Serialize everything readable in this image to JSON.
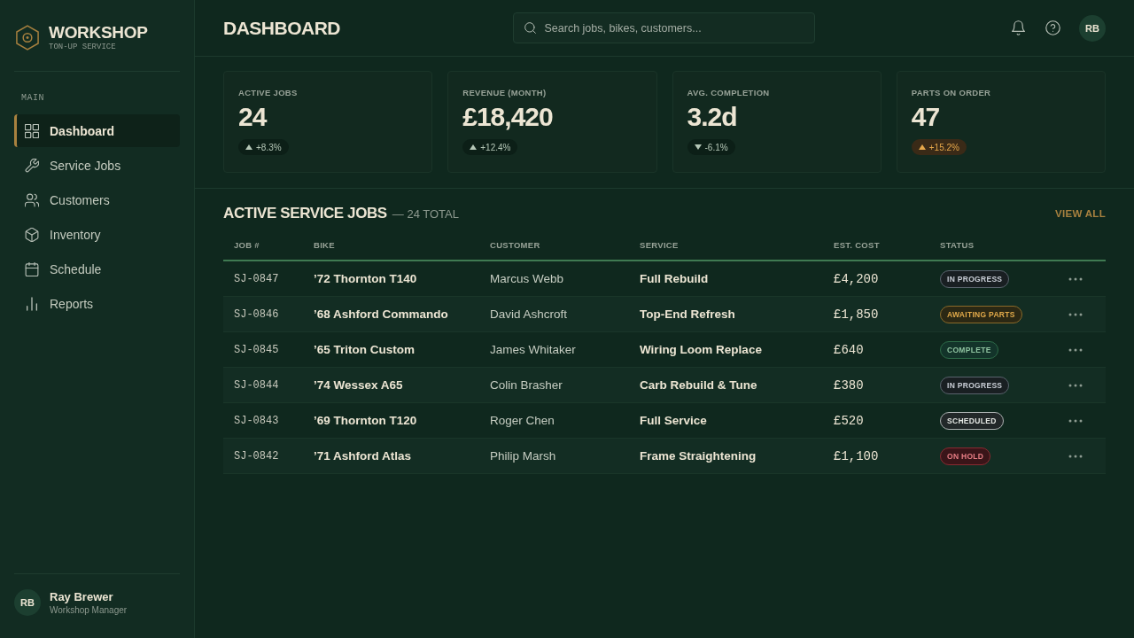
{
  "sidebar": {
    "brand": {
      "name": "WORKSHOP",
      "tagline": "TON-UP SERVICE"
    },
    "section_label": "MAIN",
    "items": [
      {
        "label": "Dashboard",
        "selected": true
      },
      {
        "label": "Service Jobs",
        "selected": false
      },
      {
        "label": "Customers",
        "selected": false
      },
      {
        "label": "Inventory",
        "selected": false
      },
      {
        "label": "Schedule",
        "selected": false
      },
      {
        "label": "Reports",
        "selected": false
      }
    ],
    "user": {
      "initials": "RB",
      "name": "Ray Brewer",
      "role": "Workshop Manager"
    }
  },
  "header": {
    "title": "DASHBOARD",
    "search": {
      "placeholder": "Search jobs, bikes, customers..."
    },
    "avatar": {
      "initials": "RB"
    }
  },
  "stats": [
    {
      "label": "ACTIVE JOBS",
      "value": "24",
      "trend": {
        "text": "+8.3%",
        "kind": "up",
        "warning": false
      }
    },
    {
      "label": "REVENUE (MONTH)",
      "value": "£18,420",
      "trend": {
        "text": "+12.4%",
        "kind": "up",
        "warning": false
      }
    },
    {
      "label": "AVG. COMPLETION",
      "value": "3.2d",
      "trend": {
        "text": "-6.1%",
        "kind": "down",
        "warning": false
      }
    },
    {
      "label": "PARTS ON ORDER",
      "value": "47",
      "trend": {
        "text": "+15.2%",
        "kind": "up",
        "warning": true
      }
    }
  ],
  "jobs_section": {
    "title": "ACTIVE SERVICE JOBS",
    "count": "— 24 TOTAL",
    "link": "VIEW ALL",
    "table": {
      "columns": [
        "JOB #",
        "BIKE",
        "CUSTOMER",
        "SERVICE",
        "EST. COST",
        "STATUS"
      ],
      "rows": [
        {
          "job": "SJ-0847",
          "bike": "’72 Thornton T140",
          "customer": "Marcus Webb",
          "service": "Full Rebuild",
          "cost": "£4,200",
          "status": {
            "label": "IN PROGRESS",
            "kind": "progress"
          }
        },
        {
          "job": "SJ-0846",
          "bike": "’68 Ashford Commando",
          "customer": "David Ashcroft",
          "service": "Top-End Refresh",
          "cost": "£1,850",
          "status": {
            "label": "AWAITING PARTS",
            "kind": "awaiting"
          }
        },
        {
          "job": "SJ-0845",
          "bike": "’65 Triton Custom",
          "customer": "James Whitaker",
          "service": "Wiring Loom Replace",
          "cost": "£640",
          "status": {
            "label": "COMPLETE",
            "kind": "complete"
          }
        },
        {
          "job": "SJ-0844",
          "bike": "’74 Wessex A65",
          "customer": "Colin Brasher",
          "service": "Carb Rebuild & Tune",
          "cost": "£380",
          "status": {
            "label": "IN PROGRESS",
            "kind": "progress"
          }
        },
        {
          "job": "SJ-0843",
          "bike": "’69 Thornton T120",
          "customer": "Roger Chen",
          "service": "Full Service",
          "cost": "£520",
          "status": {
            "label": "SCHEDULED",
            "kind": "scheduled"
          }
        },
        {
          "job": "SJ-0842",
          "bike": "’71 Ashford Atlas",
          "customer": "Philip Marsh",
          "service": "Frame Straightening",
          "cost": "£1,100",
          "status": {
            "label": "ON HOLD",
            "kind": "hold"
          }
        }
      ]
    }
  }
}
